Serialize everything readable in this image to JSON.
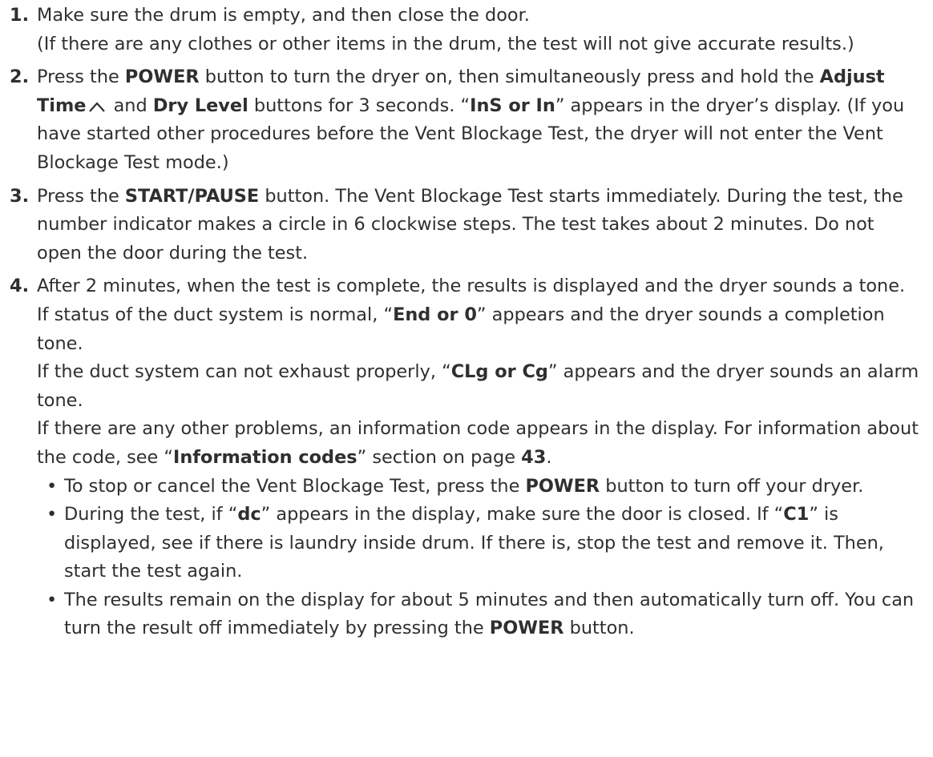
{
  "steps": [
    {
      "num": "1.",
      "p1": "Make sure the drum is empty, and then close the door.",
      "p2": "(If there are any clothes or other items in the drum, the test will not give accurate results.)"
    },
    {
      "num": "2.",
      "t1": "Press the ",
      "b1": "POWER",
      "t2": " button to turn the dryer on, then simultaneously press and hold the ",
      "b2": "Adjust Time",
      "t3": " and ",
      "b3": "Dry Level",
      "t4": " buttons for 3 seconds. “",
      "b4": "InS or In",
      "t5": "” appears in the dryer’s display. (If you have started other procedures before the Vent Blockage Test, the dryer will not enter the Vent Blockage Test mode.)"
    },
    {
      "num": "3.",
      "t1": "Press the ",
      "b1": "START/PAUSE",
      "t2": " button. The Vent Blockage Test starts immediately. During the test, the number indicator makes a circle in 6 clockwise steps. The test takes about 2 minutes. Do not open the door during the test."
    },
    {
      "num": "4.",
      "p1": "After 2 minutes, when the test is complete, the results is displayed and the dryer sounds a tone.",
      "p2a": "If status of the duct system is normal, “",
      "p2b": "End or 0",
      "p2c": "” appears and the dryer sounds a completion tone.",
      "p3a": "If the duct system can not exhaust properly, “",
      "p3b": "CLg or Cg",
      "p3c": "” appears and the dryer sounds an alarm tone.",
      "p4a": "If there are any other problems, an information code appears in the display. For information about the code, see “",
      "p4b": "Information codes",
      "p4c": "” section on page ",
      "p4d": "43",
      "p4e": ".",
      "bullets": [
        {
          "dot": "•",
          "t1": "To stop or cancel the Vent Blockage Test, press the ",
          "b1": "POWER",
          "t2": " button to turn off your dryer."
        },
        {
          "dot": "•",
          "t1": "During the test, if “",
          "b1": "dc",
          "t2": "” appears in the display, make sure the door is closed. If “",
          "b2": "C1",
          "t3": "” is displayed, see if there is laundry inside drum. If there is, stop the test and remove it. Then, start the test again."
        },
        {
          "dot": "•",
          "t1": "The results remain on the display for about 5 minutes and then automatically turn off. You can turn the result off immediately by pressing the ",
          "b1": "POWER",
          "t2": " button."
        }
      ]
    }
  ],
  "icons": {
    "adjust_time_up": "caret-up-icon"
  }
}
